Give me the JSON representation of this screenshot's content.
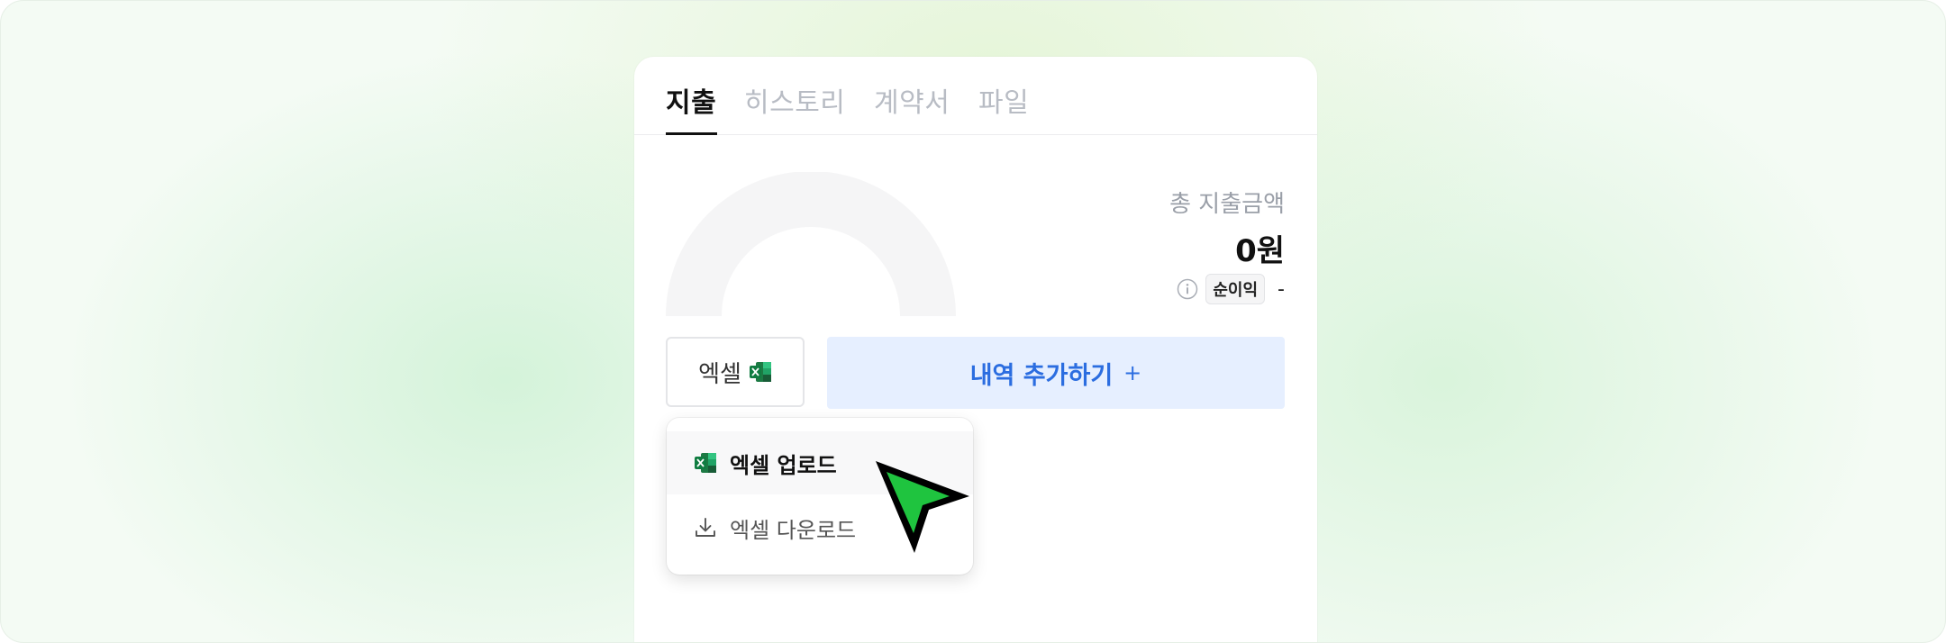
{
  "tabs": [
    {
      "label": "지출",
      "active": true
    },
    {
      "label": "히스토리",
      "active": false
    },
    {
      "label": "계약서",
      "active": false
    },
    {
      "label": "파일",
      "active": false
    }
  ],
  "summary": {
    "total_label": "총 지출금액",
    "total_value": "0원",
    "badge_label": "순이익",
    "badge_value": "-"
  },
  "actions": {
    "excel_label": "엑셀",
    "add_label": "내역 추가하기",
    "add_plus": "+"
  },
  "dropdown": {
    "items": [
      {
        "label": "엑셀 업로드",
        "icon": "excel-icon"
      },
      {
        "label": "엑셀 다운로드",
        "icon": "download-icon"
      }
    ]
  },
  "colors": {
    "accent_blue": "#2b6de0",
    "accent_bg": "#e6efff",
    "cursor_green": "#1fc43f",
    "excel_green": "#1d7a44"
  }
}
